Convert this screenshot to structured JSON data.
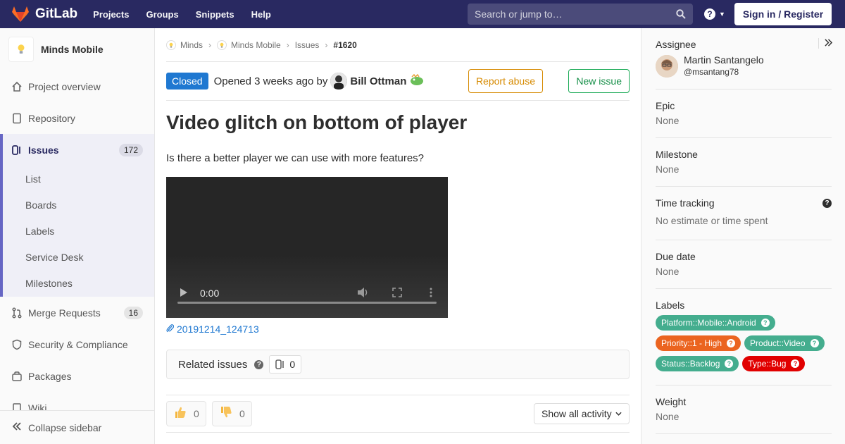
{
  "app": {
    "brand": "GitLab",
    "nav": [
      "Projects",
      "Groups",
      "Snippets",
      "Help"
    ],
    "search_placeholder": "Search or jump to…",
    "signin_label": "Sign in / Register",
    "help_symbol": "?",
    "colors": {
      "navbar": "#292961",
      "accent": "#6666c4",
      "link": "#1f78d1"
    }
  },
  "sidebar": {
    "project_name": "Minds Mobile",
    "items": [
      {
        "label": "Project overview",
        "icon": "home-icon"
      },
      {
        "label": "Repository",
        "icon": "doc-icon"
      },
      {
        "label": "Issues",
        "icon": "issues-icon",
        "count": "172"
      },
      {
        "label": "Merge Requests",
        "icon": "merge-request-icon",
        "count": "16"
      },
      {
        "label": "Security & Compliance",
        "icon": "shield-icon"
      },
      {
        "label": "Packages",
        "icon": "package-icon"
      },
      {
        "label": "Wiki",
        "icon": "book-icon"
      }
    ],
    "subitems": [
      "List",
      "Boards",
      "Labels",
      "Service Desk",
      "Milestones"
    ],
    "collapse_label": "Collapse sidebar"
  },
  "breadcrumb": {
    "items": [
      "Minds",
      "Minds Mobile",
      "Issues",
      "#1620"
    ]
  },
  "issue": {
    "status": "Closed",
    "opened_text": "Opened 3 weeks ago by",
    "author": "Bill Ottman",
    "report_label": "Report abuse",
    "new_label": "New issue",
    "title": "Video glitch on bottom of player",
    "description": "Is there a better player we can use with more features?",
    "video_time": "0:00",
    "attachment": "20191214_124713",
    "related_label": "Related issues",
    "related_count": "0",
    "thumbs_up": "0",
    "thumbs_down": "0",
    "activity_label": "Show all activity"
  },
  "right": {
    "assignee_label": "Assignee",
    "assignee_name": "Martin Santangelo",
    "assignee_handle": "@msantang78",
    "epic_label": "Epic",
    "epic_value": "None",
    "milestone_label": "Milestone",
    "milestone_value": "None",
    "time_label": "Time tracking",
    "time_value": "No estimate or time spent",
    "due_label": "Due date",
    "due_value": "None",
    "labels_label": "Labels",
    "labels": [
      {
        "text": "Platform::Mobile::Android",
        "color": "#44ad8e"
      },
      {
        "text": "Priority::1 - High",
        "color": "#eb6420"
      },
      {
        "text": "Product::Video",
        "color": "#44ad8e"
      },
      {
        "text": "Status::Backlog",
        "color": "#44ad8e"
      },
      {
        "text": "Type::Bug",
        "color": "#e10000"
      }
    ],
    "weight_label": "Weight",
    "weight_value": "None"
  }
}
